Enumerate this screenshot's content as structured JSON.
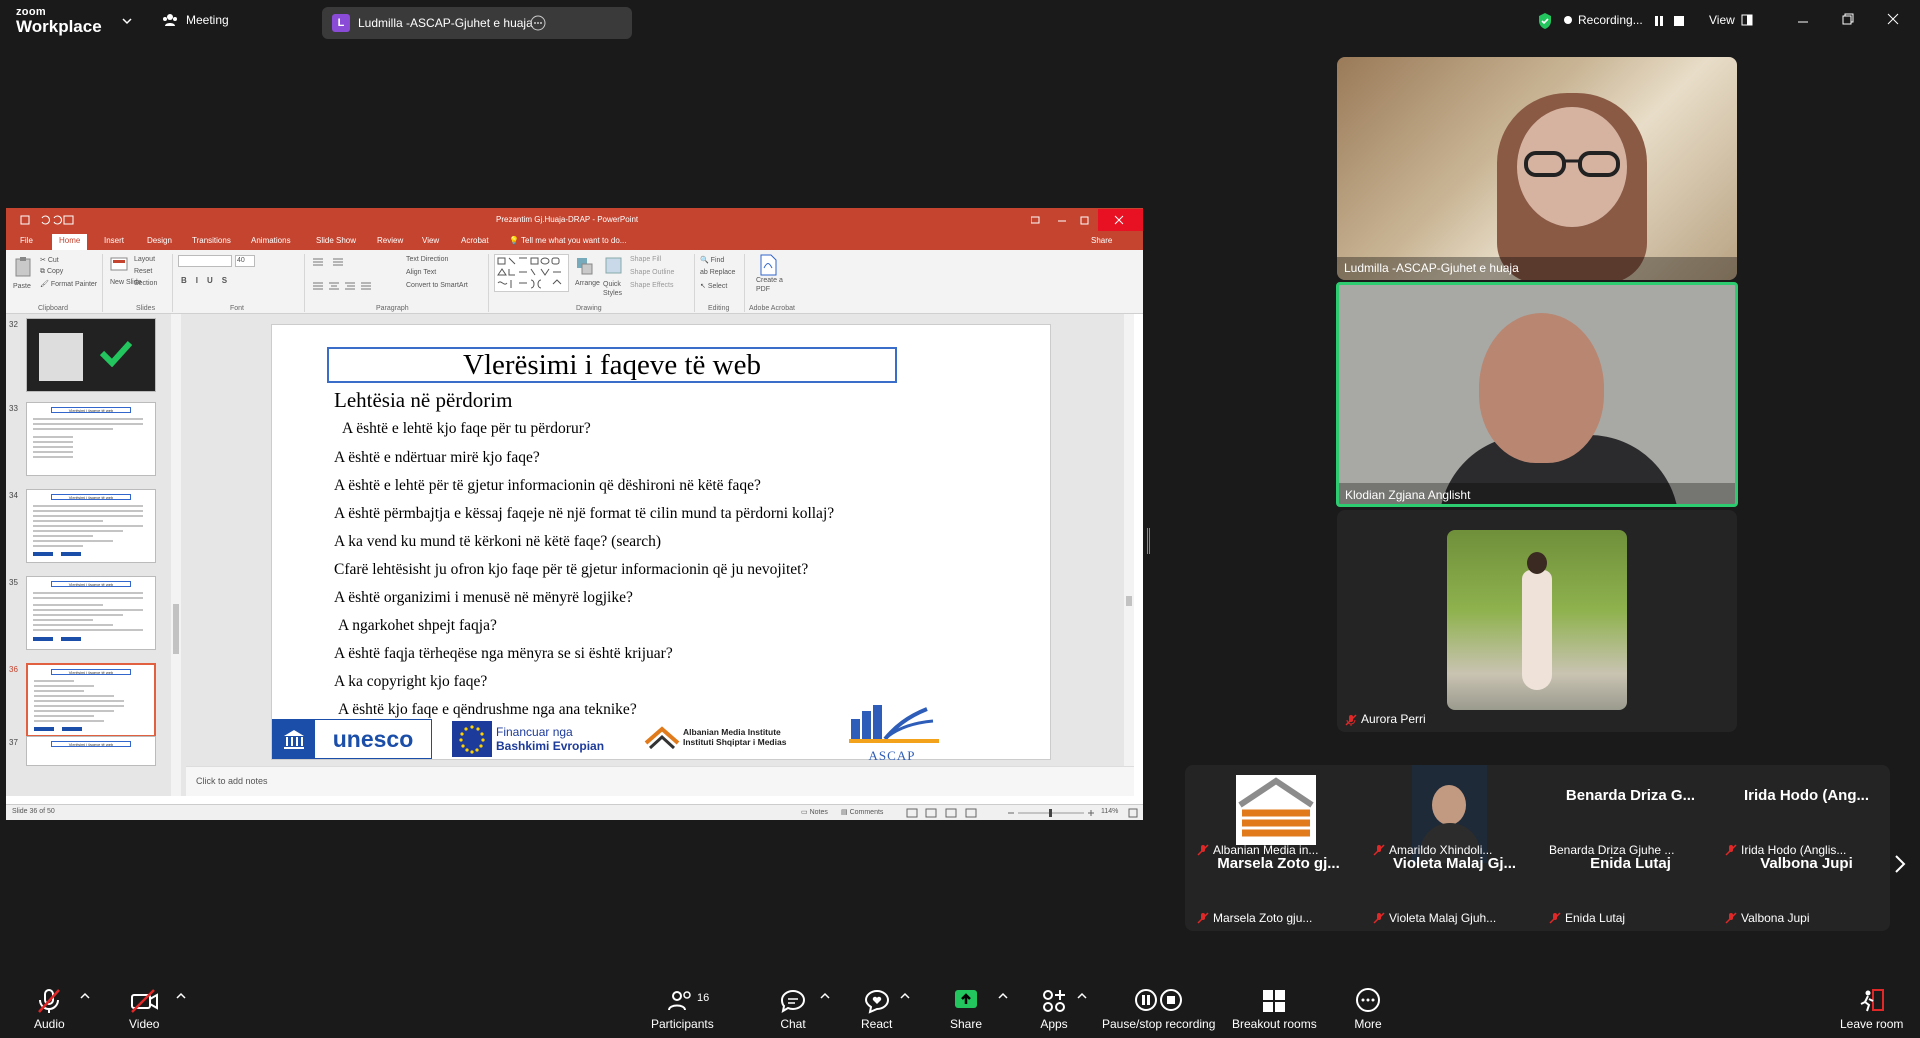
{
  "app": {
    "brand_top": "zoom",
    "brand_bottom": "Workplace",
    "meeting_label": "Meeting",
    "shared_by": "Ludmilla -ASCAP-Gjuhet e huaja",
    "shared_initial": "L",
    "recording": "Recording...",
    "view": "View"
  },
  "ppt": {
    "title": "Prezantim Gj.Huaja-DRAP - PowerPoint",
    "tabs": [
      "File",
      "Home",
      "Insert",
      "Design",
      "Transitions",
      "Animations",
      "Slide Show",
      "Review",
      "View",
      "Acrobat"
    ],
    "tell_me": "Tell me what you want to do...",
    "share": "Share",
    "ribbon": {
      "clipboard": "Clipboard",
      "paste": "Paste",
      "cut": "Cut",
      "copy": "Copy",
      "format_painter": "Format Painter",
      "slides": "Slides",
      "new_slide": "New Slide",
      "layout": "Layout",
      "reset": "Reset",
      "section": "Section",
      "font": "Font",
      "font_size": "40",
      "paragraph": "Paragraph",
      "text_direction": "Text Direction",
      "align_text": "Align Text",
      "convert_smartart": "Convert to SmartArt",
      "drawing": "Drawing",
      "arrange": "Arrange",
      "quick_styles": "Quick Styles",
      "shape_fill": "Shape Fill",
      "shape_outline": "Shape Outline",
      "shape_effects": "Shape Effects",
      "editing": "Editing",
      "find": "Find",
      "replace": "Replace",
      "select": "Select",
      "adobe": "Adobe Acrobat",
      "create_pdf": "Create a PDF"
    },
    "thumb_numbers": [
      "32",
      "33",
      "34",
      "35",
      "36",
      "37"
    ],
    "thumb_title": "Vlerësimi i faqeve të web",
    "slide": {
      "title": "Vlerësimi i faqeve të web",
      "subtitle": "Lehtësia në përdorim",
      "lines": [
        "A është e lehtë kjo faqe për tu përdorur?",
        "A është e ndërtuar mirë kjo faqe?",
        "A është e lehtë për të gjetur informacionin që dëshironi në këtë faqe?",
        "A është përmbajtja e këssaj faqeje në një format të cilin mund ta përdorni kollaj?",
        "A ka vend ku mund të kërkoni në këtë faqe? (search)",
        "Cfarë lehtësisht ju ofron kjo faqe për të gjetur informacionin që ju nevojitet?",
        "A është organizimi i menusë në mënyrë logjike?",
        "A ngarkohet shpejt faqja?",
        "A është faqja tërheqëse nga mënyra se si është krijuar?",
        "A ka copyright kjo faqe?",
        "A është kjo faqe e qëndrushme nga ana teknike?"
      ],
      "logo_unesco": "unesco",
      "logo_eu_1": "Financuar nga",
      "logo_eu_2": "Bashkimi Evropian",
      "logo_ami_1": "Albanian Media Institute",
      "logo_ami_2": "Instituti Shqiptar i Medias",
      "logo_ascap": "ASCAP"
    },
    "notes_placeholder": "Click to add notes",
    "status_slide": "Slide 36 of 50",
    "status_notes": "Notes",
    "status_comments": "Comments",
    "zoom": "114%"
  },
  "participants_video": [
    {
      "name": "Ludmilla -ASCAP-Gjuhet e huaja"
    },
    {
      "name": "Klodian Zgjana Anglisht"
    },
    {
      "name": "Aurora Perri"
    }
  ],
  "gallery": [
    {
      "big": "",
      "label": "Albanian Media in..."
    },
    {
      "big": "",
      "label": "Amarildo Xhindoli..."
    },
    {
      "big": "Benarda Driza G...",
      "label": "Benarda Driza Gjuhe ..."
    },
    {
      "big": "Irida Hodo (Ang...",
      "label": "Irida Hodo (Anglis..."
    },
    {
      "big": "Marsela Zoto gj...",
      "label": "Marsela Zoto gju..."
    },
    {
      "big": "Violeta Malaj Gj...",
      "label": "Violeta Malaj Gjuh..."
    },
    {
      "big": "Enida Lutaj",
      "label": "Enida Lutaj"
    },
    {
      "big": "Valbona Jupi",
      "label": "Valbona Jupi"
    }
  ],
  "toolbar": {
    "audio": "Audio",
    "video": "Video",
    "participants": "Participants",
    "participants_count": "16",
    "chat": "Chat",
    "react": "React",
    "share": "Share",
    "apps": "Apps",
    "pause_stop": "Pause/stop recording",
    "breakout": "Breakout rooms",
    "more": "More",
    "leave": "Leave room"
  },
  "colors": {
    "accent_ppt": "#c4442f",
    "active_speaker": "#2ecc71",
    "share_green": "#22c55e"
  }
}
